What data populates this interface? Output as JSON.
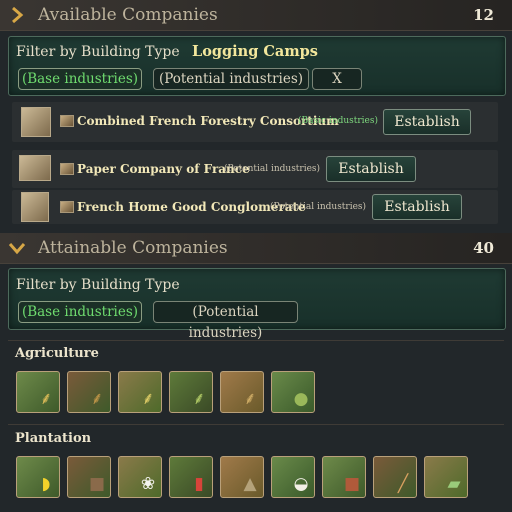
{
  "available": {
    "title": "Available Companies",
    "count": "12",
    "filter_label": "Filter by Building Type",
    "filter_value": "Logging Camps",
    "pill_base": "(Base industries)",
    "pill_potential": "(Potential industries)",
    "clear_label": "X",
    "companies": [
      {
        "name": "Combined French Forestry Consortium",
        "tag": "(Basic industries)",
        "button": "Establish"
      },
      {
        "name": "Paper Company of France",
        "tag": "(Potential industries)",
        "button": "Establish"
      },
      {
        "name": "French Home Good Conglomerate",
        "tag": "(Potential industries)",
        "button": "Establish"
      }
    ]
  },
  "attainable": {
    "title": "Attainable Companies",
    "count": "40",
    "filter_label": "Filter by Building Type",
    "pill_base": "(Base industries)",
    "pill_potential": "(Potential industries)"
  },
  "categories": {
    "agriculture": {
      "title": "Agriculture",
      "icons": [
        "wheat-farm-icon",
        "rye-farm-icon",
        "maize-farm-icon",
        "rice-farm-icon",
        "millet-farm-icon",
        "vineyard-icon"
      ]
    },
    "plantation": {
      "title": "Plantation",
      "icons": [
        "banana-plantation-icon",
        "coffee-plantation-icon",
        "cotton-plantation-icon",
        "dye-plantation-icon",
        "opium-plantation-icon",
        "tea-plantation-icon",
        "tobacco-plantation-icon",
        "silk-plantation-icon",
        "sugar-plantation-icon"
      ]
    }
  },
  "colors": {
    "accent_green": "#6fdc6f",
    "name_gold": "#f2e8b8",
    "panel_green": "#1f3a33"
  }
}
